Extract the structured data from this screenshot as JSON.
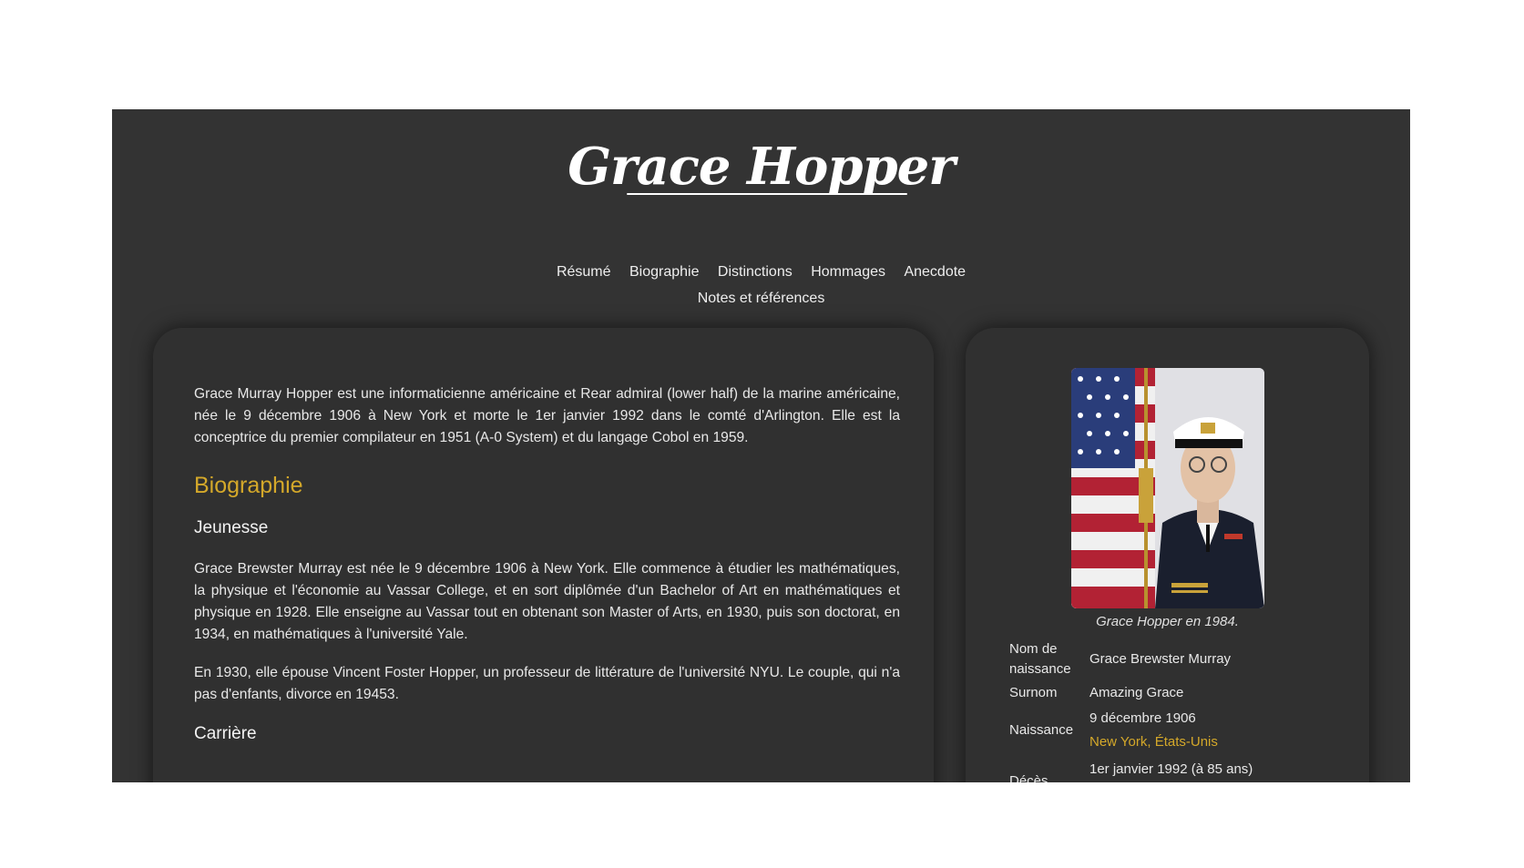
{
  "site": {
    "title": "Grace Hopper"
  },
  "nav": {
    "row1": [
      "Résumé",
      "Biographie",
      "Distinctions",
      "Hommages",
      "Anecdote"
    ],
    "row2": [
      "Notes et références"
    ]
  },
  "main": {
    "intro": "Grace Murray Hopper est une informaticienne américaine et Rear admiral (lower half) de la marine américaine, née le 9 décembre 1906 à New York et morte le 1er janvier 1992 dans le comté d'Arlington. Elle est la conceptrice du premier compilateur en 1951 (A-0 System) et du langage Cobol en 1959.",
    "section_title": "Biographie",
    "subsection1_title": "Jeunesse",
    "para1": "Grace Brewster Murray est née le 9 décembre 1906 à New York. Elle commence à étudier les mathématiques, la physique et l'économie au Vassar College, et en sort diplômée d'un Bachelor of Art en mathématiques et physique en 1928. Elle enseigne au Vassar tout en obtenant son Master of Arts, en 1930, puis son doctorat, en 1934, en mathématiques à l'université Yale.",
    "para2": "En 1930, elle épouse Vincent Foster Hopper, un professeur de littérature de l'université NYU. Le couple, qui n'a pas d'enfants, divorce en 19453.",
    "subsection2_title": "Carrière"
  },
  "sidebar": {
    "portrait_caption": "Grace Hopper en 1984.",
    "infobox": {
      "birth_name_label": "Nom de naissance",
      "birth_name_value": "Grace Brewster Murray",
      "nickname_label": "Surnom",
      "nickname_value": "Amazing Grace",
      "birth_label": "Naissance",
      "birth_date": "9 décembre 1906",
      "birth_place": "New York, États-Unis",
      "death_label": "Décès",
      "death_date": "1er janvier 1992 (à 85 ans)"
    }
  },
  "colors": {
    "page_background": "#ffffff",
    "frame_background": "#333333",
    "card_background": "#303030",
    "accent": "#d4a82a",
    "text": "#e8e8e8"
  },
  "icons": {
    "portrait": "portrait-photo"
  }
}
